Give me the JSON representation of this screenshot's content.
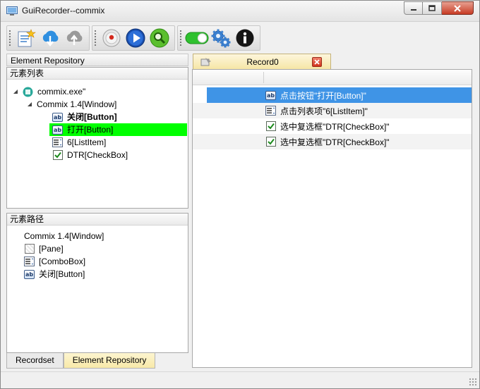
{
  "window": {
    "title": "GuiRecorder--commix"
  },
  "toolbar": {
    "buttons": [
      {
        "name": "new-project",
        "icon": "new-document-icon"
      },
      {
        "name": "download",
        "icon": "cloud-download-icon"
      },
      {
        "name": "upload",
        "icon": "cloud-upload-icon"
      },
      {
        "name": "record",
        "icon": "record-icon"
      },
      {
        "name": "play",
        "icon": "play-icon"
      },
      {
        "name": "spy",
        "icon": "magnifier-icon"
      },
      {
        "name": "toggle",
        "icon": "toggle-on-icon"
      },
      {
        "name": "settings",
        "icon": "gears-icon"
      },
      {
        "name": "info",
        "icon": "info-icon"
      }
    ]
  },
  "left": {
    "header": "Element Repository",
    "element_list": {
      "title": "元素列表",
      "root": "commix.exe\"",
      "window": "Commix 1.4[Window]",
      "items": [
        {
          "label": "关闭[Button]",
          "type": "button"
        },
        {
          "label": "打开[Button]",
          "type": "button"
        },
        {
          "label": "6[ListItem]",
          "type": "listitem"
        },
        {
          "label": "DTR[CheckBox]",
          "type": "checkbox"
        }
      ]
    },
    "element_path": {
      "title": "元素路径",
      "items": [
        {
          "label": "Commix 1.4[Window]",
          "type": "window"
        },
        {
          "label": "[Pane]",
          "type": "pane"
        },
        {
          "label": "[ComboBox]",
          "type": "combobox"
        },
        {
          "label": "关闭[Button]",
          "type": "button"
        }
      ]
    },
    "tabs": [
      {
        "label": "Recordset",
        "active": false
      },
      {
        "label": "Element Repository",
        "active": true
      }
    ]
  },
  "right": {
    "tab": {
      "label": "Record0"
    },
    "rows": [
      {
        "text": "点击按钮\"打开[Button]\"",
        "type": "button",
        "selected": true
      },
      {
        "text": "点击列表项\"6[ListItem]\"",
        "type": "listitem",
        "selected": false
      },
      {
        "text": "选中复选框\"DTR[CheckBox]\"",
        "type": "checkbox",
        "selected": false
      },
      {
        "text": "选中复选框\"DTR[CheckBox]\"",
        "type": "checkbox",
        "selected": false
      }
    ]
  },
  "colors": {
    "selection_blue": "#3f94e6",
    "highlight_green": "#00ff00",
    "active_tab": "#f8e9a8"
  }
}
